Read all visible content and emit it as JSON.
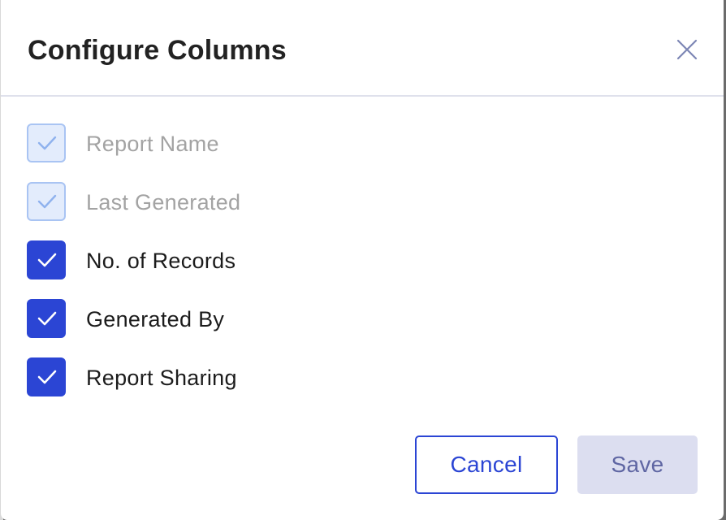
{
  "dialog": {
    "title": "Configure Columns",
    "close_icon": "close-icon",
    "columns": [
      {
        "label": "Report Name",
        "checked": true,
        "disabled": true
      },
      {
        "label": "Last Generated",
        "checked": true,
        "disabled": true
      },
      {
        "label": "No. of Records",
        "checked": true,
        "disabled": false
      },
      {
        "label": "Generated By",
        "checked": true,
        "disabled": false
      },
      {
        "label": "Report Sharing",
        "checked": true,
        "disabled": false
      }
    ],
    "cancel_label": "Cancel",
    "save_label": "Save",
    "save_enabled": false
  },
  "colors": {
    "accent": "#2b45d4",
    "disabled_checkbox_fill": "#e3ecfc",
    "disabled_checkbox_border": "#a9c4f3",
    "save_disabled_bg": "#dcdef0",
    "save_disabled_text": "#5f66a3"
  }
}
